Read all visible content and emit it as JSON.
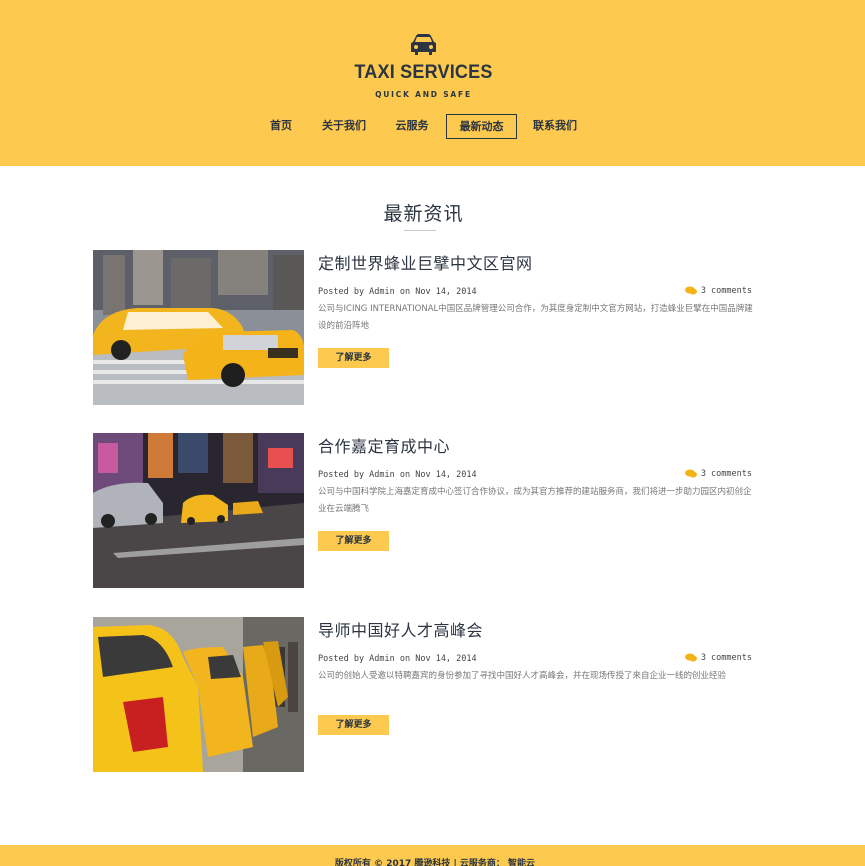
{
  "header": {
    "brand": "TAXI SERVICES",
    "tagline": "QUICK AND SAFE",
    "logo_icon": "car-icon",
    "background_color": "#fdc94f",
    "text_color": "#2b3542"
  },
  "nav": {
    "items": [
      {
        "label": "首页"
      },
      {
        "label": "关于我们"
      },
      {
        "label": "云服务"
      },
      {
        "label": "最新动态",
        "active": true
      },
      {
        "label": "联系我们"
      }
    ]
  },
  "main": {
    "section_title": "最新资讯",
    "articles": [
      {
        "title": "定制世界蜂业巨擘中文区官网",
        "meta": "Posted by Admin on Nov 14, 2014",
        "comments": "3 comments",
        "excerpt": "公司与ICING INTERNATIONAL中国区品牌管理公司合作，为其度身定制中文官方网站，打造蜂业巨擘在中国品牌建设的前沿阵地",
        "more_label": "了解更多"
      },
      {
        "title": "合作嘉定育成中心",
        "meta": "Posted by Admin on Nov 14, 2014",
        "comments": "3 comments",
        "excerpt": "公司与中国科学院上海嘉定育成中心签订合作协议，成为其官方推荐的建站服务商，我们将进一步助力园区内初创企业在云端腾飞",
        "more_label": "了解更多"
      },
      {
        "title": "导师中国好人才高峰会",
        "meta": "Posted by Admin on Nov 14, 2014",
        "comments": "3 comments",
        "excerpt": "公司的创始人受邀以特聘嘉宾的身份参加了寻找中国好人才高峰会，并在现场传授了来自企业一线的创业经验",
        "more_label": "了解更多"
      }
    ]
  },
  "footer": {
    "text": "版权所有 © 2017 腾逊科技 | 云服务商： 智能云"
  }
}
